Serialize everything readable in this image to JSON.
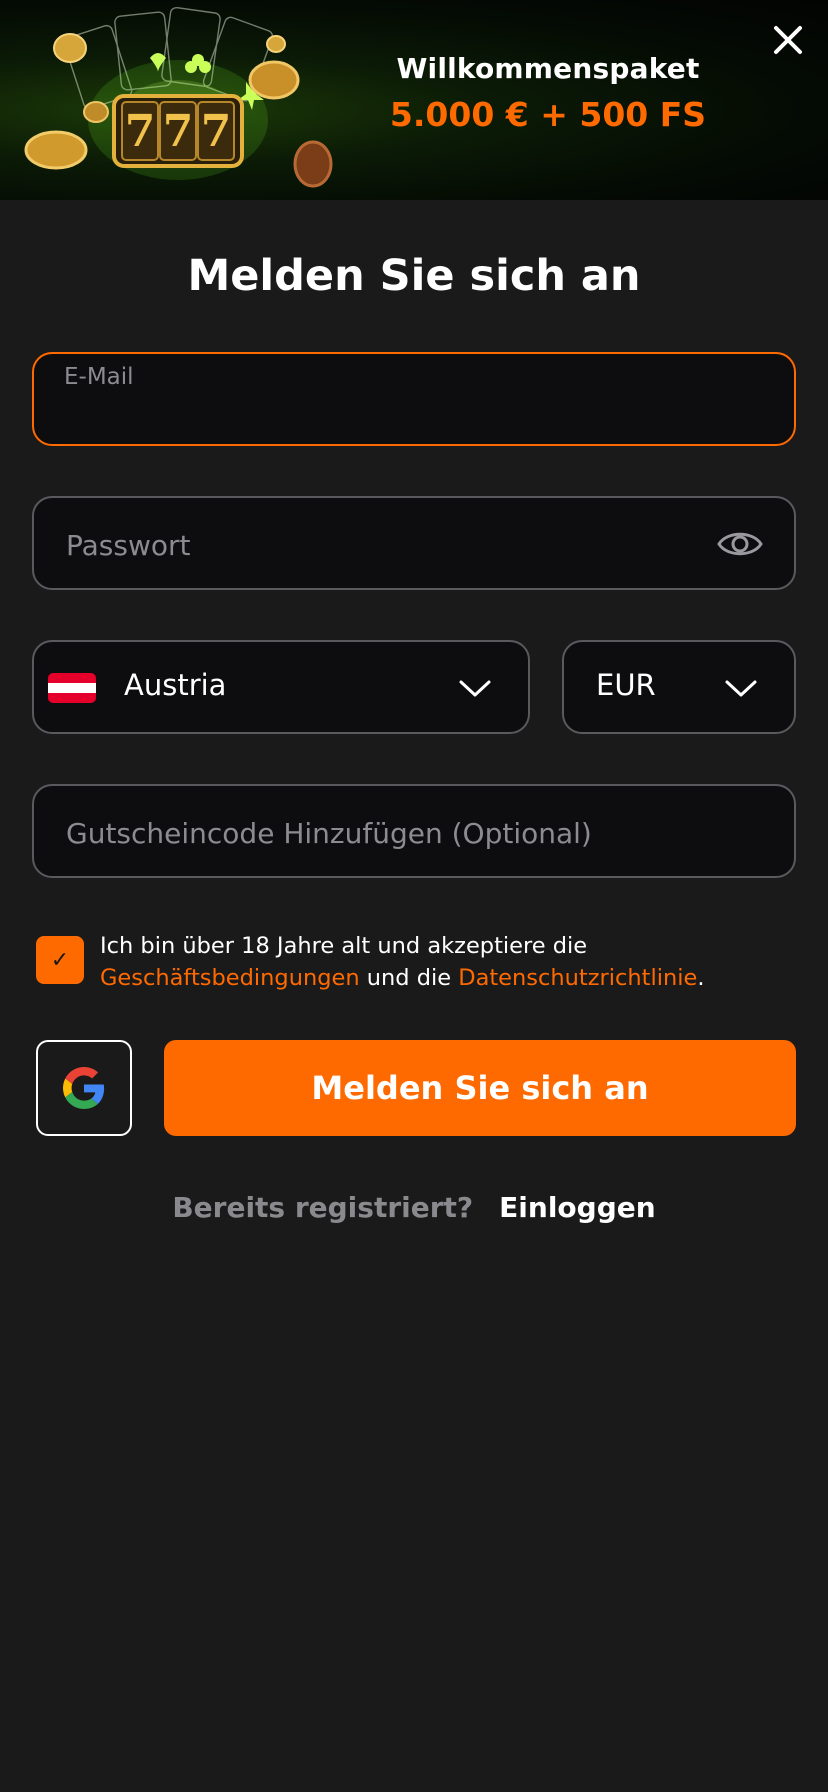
{
  "banner": {
    "title": "Willkommenspaket",
    "amount": "5.000 € + 500 FS",
    "slot_digits": [
      "7",
      "7",
      "7"
    ]
  },
  "form": {
    "title": "Melden Sie sich an",
    "email": {
      "label": "E-Mail",
      "value": ""
    },
    "password": {
      "placeholder": "Passwort",
      "value": ""
    },
    "country": {
      "selected": "Austria"
    },
    "currency": {
      "selected": "EUR"
    },
    "promo": {
      "placeholder": "Gutscheincode Hinzufügen (Optional)",
      "value": ""
    },
    "terms": {
      "checked": true,
      "check_glyph": "✓",
      "text_before": "Ich bin über 18 Jahre alt und akzeptiere die ",
      "terms_link": "Geschäftsbedingungen",
      "text_middle": " und die ",
      "privacy_link": "Datenschutzrichtlinie",
      "text_after": "."
    },
    "submit_label": "Melden Sie sich an",
    "google_icon": "google-icon",
    "login_prompt": "Bereits registriert?",
    "login_link": "Einloggen"
  },
  "colors": {
    "accent": "#ff6a00",
    "background": "#1a1a1b",
    "field_border": "#5a5a5e",
    "flag_red": "#e4002b",
    "flag_white": "#ffffff"
  }
}
